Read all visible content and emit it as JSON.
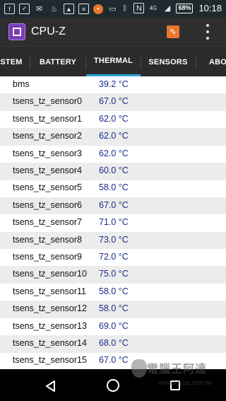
{
  "status_bar": {
    "left_icons": [
      "facebook-icon",
      "checkbox-icon",
      "mail-icon",
      "fire-icon",
      "gallery-icon",
      "note-icon",
      "app-badge-icon",
      "tv-icon"
    ],
    "right_icons": [
      "bluetooth-icon",
      "nfc-icon",
      "signal-icon"
    ],
    "network": "4G",
    "battery": "68%",
    "time": "10:18"
  },
  "app_bar": {
    "title": "CPU-Z"
  },
  "tabs": [
    {
      "label": "STEM"
    },
    {
      "label": "BATTERY"
    },
    {
      "label": "THERMAL"
    },
    {
      "label": "SENSORS"
    },
    {
      "label": "ABO"
    }
  ],
  "selected_tab": "THERMAL",
  "thermal": [
    {
      "name": "bms",
      "value": "39.2 °C"
    },
    {
      "name": "tsens_tz_sensor0",
      "value": "67.0 °C"
    },
    {
      "name": "tsens_tz_sensor1",
      "value": "62.0 °C"
    },
    {
      "name": "tsens_tz_sensor2",
      "value": "62.0 °C"
    },
    {
      "name": "tsens_tz_sensor3",
      "value": "62.0 °C"
    },
    {
      "name": "tsens_tz_sensor4",
      "value": "60.0 °C"
    },
    {
      "name": "tsens_tz_sensor5",
      "value": "58.0 °C"
    },
    {
      "name": "tsens_tz_sensor6",
      "value": "67.0 °C"
    },
    {
      "name": "tsens_tz_sensor7",
      "value": "71.0 °C"
    },
    {
      "name": "tsens_tz_sensor8",
      "value": "73.0 °C"
    },
    {
      "name": "tsens_tz_sensor9",
      "value": "72.0 °C"
    },
    {
      "name": "tsens_tz_sensor10",
      "value": "75.0 °C"
    },
    {
      "name": "tsens_tz_sensor11",
      "value": "58.0 °C"
    },
    {
      "name": "tsens_tz_sensor12",
      "value": "58.0 °C"
    },
    {
      "name": "tsens_tz_sensor13",
      "value": "69.0 °C"
    },
    {
      "name": "tsens_tz_sensor14",
      "value": "68.0 °C"
    },
    {
      "name": "tsens_tz_sensor15",
      "value": "67.0 °C"
    }
  ],
  "colors": {
    "accent": "#29a9d6",
    "value_text": "#1a2a8a",
    "app_icon": "#7a3cb8",
    "validate_icon": "#e8762c"
  },
  "watermark": {
    "main": "電腦王阿達",
    "sub": "www.kocpc.com.tw"
  }
}
